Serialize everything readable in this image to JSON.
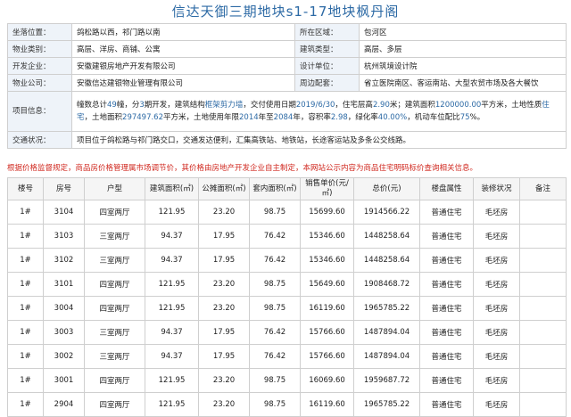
{
  "title": "信达天御三期地块s1-17地块枫丹阁",
  "info": {
    "location_label": "坐落位置：",
    "location": "鸽松路以西，祁门路以南",
    "district_label": "所在区域：",
    "district": "包河区",
    "type_label": "物业类别：",
    "type": "高层、洋房、商铺、公寓",
    "building_label": "建筑类型：",
    "building": "高层、多层",
    "developer_label": "开发企业：",
    "developer": "安徽建银房地产开发有限公司",
    "design_label": "设计单位：",
    "design": "杭州筑境设计院",
    "property_label": "物业公司：",
    "property": "安徽信达建银物业管理有限公司",
    "surround_label": "周边配套：",
    "surround": "省立医院南区、客运南站、大型农贸市场及各大餐饮",
    "project_label": "项目信息：",
    "project": {
      "p1": "幢数总计",
      "buildings": "49",
      "p2": "幢，分",
      "phases": "3",
      "p3": "期开发，建筑结构",
      "structure": "框架剪力墙",
      "p4": "，交付使用日期",
      "delivery": "2019/6/30",
      "p5": "，住宅层高",
      "floor_height": "2.90",
      "p6": "米；建筑面积",
      "build_area": "1200000.00",
      "p7": "平方米，土地性质",
      "land_type": "住宅",
      "p8": "，土地面积",
      "land_area": "297497.62",
      "p9": "平方米，土地使用年限",
      "year_start": "2014",
      "p10": "年至",
      "year_end": "2084",
      "p11": "年，容积率",
      "far": "2.98",
      "p12": "，绿化率",
      "green": "40.00%",
      "p13": "，机动车位配比",
      "parking": "75",
      "p14": "%。"
    },
    "traffic_label": "交通状况：",
    "traffic": "项目位于鸽松路与祁门路交口，交通发达便利，汇集高铁站、地铁站，长途客运站及多条公交线路。"
  },
  "notice": "根据价格监督规定，商品房价格管理属市场调节价，其价格由房地产开发企业自主制定，本网站公示内容为商品住宅明码标价查询相关信息。",
  "table": {
    "headers": {
      "building": "楼号",
      "room": "房号",
      "layout": "户型",
      "build_area": "建筑面积(㎡)",
      "shared_area": "公摊面积(㎡)",
      "inner_area": "套内面积(㎡)",
      "unit_price": "销售单价(元/㎡)",
      "total": "总价(元)",
      "attr": "楼盘属性",
      "decor": "装修状况",
      "note": "备注"
    },
    "rows": [
      [
        "1#",
        "3104",
        "四室两厅",
        "121.95",
        "23.20",
        "98.75",
        "15699.60",
        "1914566.22",
        "普通住宅",
        "毛坯房",
        ""
      ],
      [
        "1#",
        "3103",
        "三室两厅",
        "94.37",
        "17.95",
        "76.42",
        "15346.60",
        "1448258.64",
        "普通住宅",
        "毛坯房",
        ""
      ],
      [
        "1#",
        "3102",
        "三室两厅",
        "94.37",
        "17.95",
        "76.42",
        "15346.60",
        "1448258.64",
        "普通住宅",
        "毛坯房",
        ""
      ],
      [
        "1#",
        "3101",
        "四室两厅",
        "121.95",
        "23.20",
        "98.75",
        "15649.60",
        "1908468.72",
        "普通住宅",
        "毛坯房",
        ""
      ],
      [
        "1#",
        "3004",
        "四室两厅",
        "121.95",
        "23.20",
        "98.75",
        "16119.60",
        "1965785.22",
        "普通住宅",
        "毛坯房",
        ""
      ],
      [
        "1#",
        "3003",
        "三室两厅",
        "94.37",
        "17.95",
        "76.42",
        "15766.60",
        "1487894.04",
        "普通住宅",
        "毛坯房",
        ""
      ],
      [
        "1#",
        "3002",
        "三室两厅",
        "94.37",
        "17.95",
        "76.42",
        "15766.60",
        "1487894.04",
        "普通住宅",
        "毛坯房",
        ""
      ],
      [
        "1#",
        "3001",
        "四室两厅",
        "121.95",
        "23.20",
        "98.75",
        "16069.60",
        "1959687.72",
        "普通住宅",
        "毛坯房",
        ""
      ],
      [
        "1#",
        "2904",
        "四室两厅",
        "121.95",
        "23.20",
        "98.75",
        "16119.60",
        "1965785.22",
        "普通住宅",
        "毛坯房",
        ""
      ]
    ]
  }
}
